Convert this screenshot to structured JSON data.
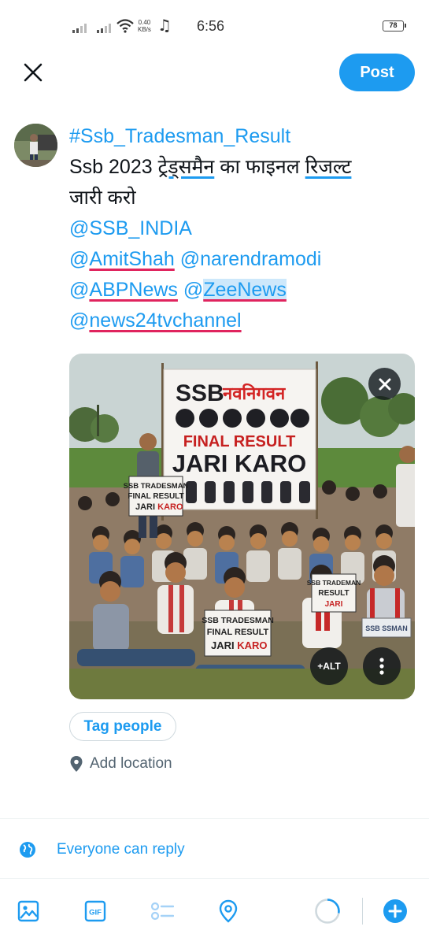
{
  "status_bar": {
    "time": "6:56",
    "net_speed_value": "0.40",
    "net_speed_unit": "KB/s",
    "battery": "78"
  },
  "header": {
    "post_label": "Post"
  },
  "tweet": {
    "line1": "#Ssb_Tradesman_Result",
    "line2_a": "Ssb 2023 ",
    "line2_b": "ट्रेड्समैन",
    "line2_c": " का फाइनल ",
    "line2_d": "रिजल्ट",
    "line3": "जारी करो",
    "line4": "@SSB_INDIA",
    "line5_at1": "@",
    "line5_name1": "AmitShah",
    "line5_rest": " @narendramodi",
    "line6_at1": "@",
    "line6_name1": "ABPNews",
    "line6_at2": " @",
    "line6_name2": "ZeeNews",
    "line7_at": "@",
    "line7_name": "news24tvchannel"
  },
  "media": {
    "banner_top": "SSB",
    "banner_hindi": "नवनिगवन",
    "banner_line1": "FINAL RESULT",
    "banner_line2": "JARI KARO",
    "sign_left_1": "SSB TRADESMAN",
    "sign_left_2": "FINAL RESULT",
    "sign_left_3a": "JARI ",
    "sign_left_3b": "KARO",
    "sign_center_1": "SSB TRADESMAN",
    "sign_center_2": "FINAL RESULT",
    "sign_center_3a": "JARI ",
    "sign_center_3b": "KARO",
    "sign_right_1": "SSB TRADEMAN",
    "sign_right_2": "RESULT",
    "sign_right_3": "JARI",
    "sign_far_right": "SSB SSMAN",
    "alt_label": "+ALT"
  },
  "actions": {
    "tag_people": "Tag people",
    "add_location": "Add location",
    "reply_setting": "Everyone can reply"
  },
  "colors": {
    "accent": "#1d9bf0",
    "underline_red": "#e0245e"
  }
}
